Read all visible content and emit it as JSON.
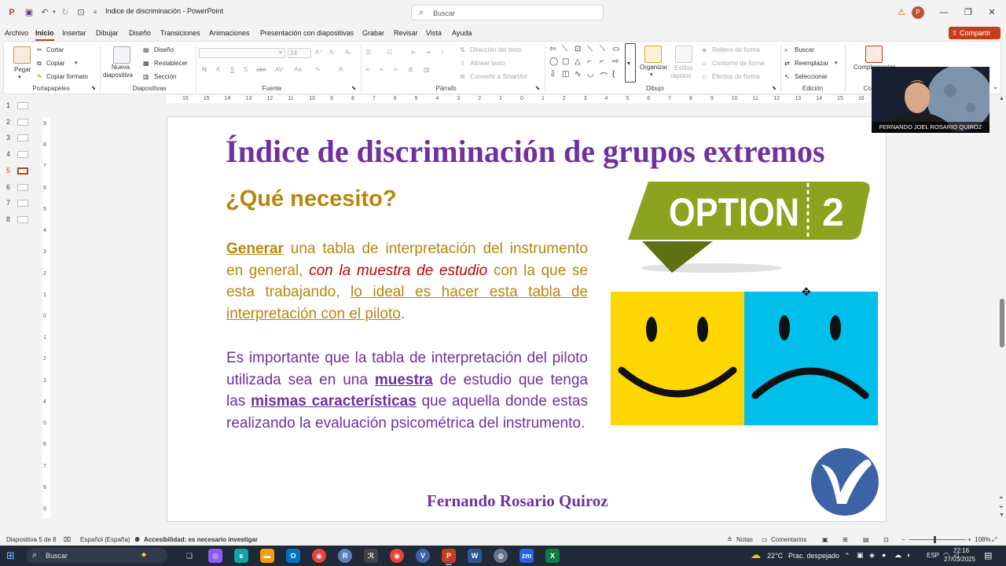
{
  "titlebar": {
    "doc_title": "Indice de discriminación  -  PowerPoint",
    "search_placeholder": "Buscar",
    "user_initial": "P"
  },
  "menu": {
    "tabs": [
      "Archivo",
      "Inicio",
      "Insertar",
      "Dibujar",
      "Diseño",
      "Transiciones",
      "Animaciones",
      "Presentación con diapositivas",
      "Grabar",
      "Revisar",
      "Vista",
      "Ayuda"
    ],
    "active": "Inicio",
    "share_label": "Compartir"
  },
  "ribbon": {
    "portapapeles": {
      "label": "Portapapeles",
      "paste": "Pegar",
      "cut": "Cortar",
      "copy": "Copiar",
      "format_painter": "Copiar formato"
    },
    "diapositivas": {
      "label": "Diapositivas",
      "new_slide_1": "Nueva",
      "new_slide_2": "diapositiva",
      "layout": "Diseño",
      "reset": "Restablecer",
      "section": "Sección"
    },
    "fuente": {
      "label": "Fuente",
      "font_size": "24"
    },
    "parrafo": {
      "label": "Párrafo",
      "text_direction": "Dirección del texto",
      "align_text": "Alinear texto",
      "smartart": "Convertir a SmartArt"
    },
    "dibujo": {
      "label": "Dibujo",
      "arrange": "Organizar",
      "quick_styles_1": "Estilos",
      "quick_styles_2": "rápidos",
      "shape_fill": "Relleno de forma",
      "shape_outline": "Contorno de forma",
      "shape_effects": "Efectos de forma"
    },
    "edicion": {
      "label": "Edición",
      "find": "Buscar",
      "replace": "Reemplazar",
      "select": "Seleccionar"
    },
    "complementos": {
      "label": "Complementos",
      "label_short": "Compl"
    }
  },
  "ruler": {
    "h_ticks": [
      "16",
      "15",
      "14",
      "13",
      "12",
      "11",
      "10",
      "9",
      "8",
      "7",
      "6",
      "5",
      "4",
      "3",
      "2",
      "1",
      "0",
      "1",
      "2",
      "3",
      "4",
      "5",
      "6",
      "7",
      "8",
      "9",
      "10",
      "11",
      "12",
      "13",
      "14",
      "15",
      "16"
    ],
    "v_ticks": [
      "9",
      "8",
      "7",
      "6",
      "5",
      "4",
      "3",
      "2",
      "1",
      "0",
      "1",
      "2",
      "3",
      "4",
      "5",
      "6",
      "7",
      "8",
      "9"
    ]
  },
  "thumbnails": {
    "numbers": [
      "1",
      "2",
      "3",
      "4",
      "5",
      "6",
      "7",
      "8"
    ],
    "active_index": 4
  },
  "slide": {
    "title": "Índice de discriminación de grupos extremos",
    "subtitle": "¿Qué necesito?",
    "p1": {
      "generar": "Generar",
      "t1": " una tabla de interpretación del instrumento en general, ",
      "red": "con la muestra de estudio",
      "t2": " con la que se esta trabajando, ",
      "underlined": "lo ideal es hacer esta tabla de interpretación con el piloto",
      "t3": "."
    },
    "p2": {
      "t1": "Es importante que la tabla de interpretación del piloto utilizada sea en una ",
      "muestra": "muestra",
      "t2": " de estudio que tenga las ",
      "mismas": "mismas características",
      "t3": " que aquella donde estas realizando la evaluación psicométrica del instrumento."
    },
    "option_banner": {
      "word": "OPTION",
      "number": "2"
    },
    "footer": "Fernando Rosario Quiroz",
    "colors": {
      "title": "#7030a0",
      "subtitle": "#b8860b",
      "red": "#c00000",
      "happy_bg": "#ffd700",
      "sad_bg": "#00bfea",
      "banner": "#8ba31e"
    }
  },
  "presenter": {
    "name": "FERNANDO JOEL ROSARIO QUIROZ"
  },
  "statusbar": {
    "slide_info": "Diapositiva 5 de 8",
    "language": "Español (España)",
    "accessibility": "Accesibilidad: es necesario investigar",
    "notes": "Notas",
    "comments": "Comentarios",
    "zoom": "108%"
  },
  "taskbar": {
    "search": "Buscar",
    "weather_temp": "22°C",
    "weather_desc": "Prac. despejado",
    "lang": "ESP",
    "time": "22:16",
    "date": "27/03/2025"
  }
}
